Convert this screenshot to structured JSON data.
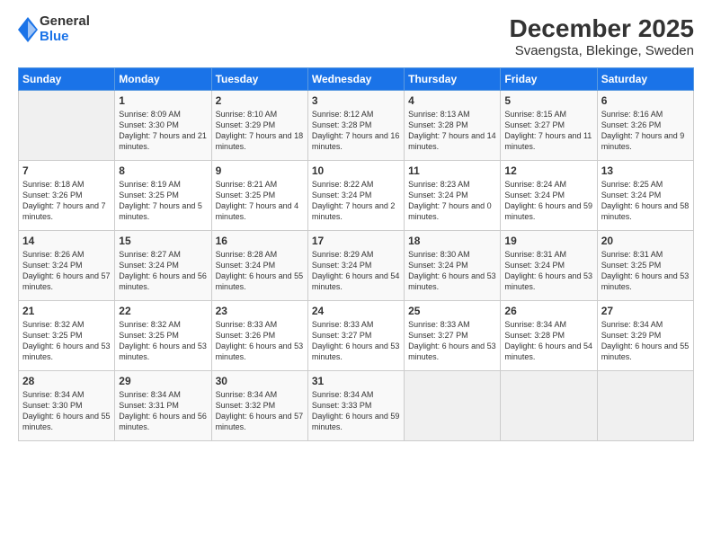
{
  "logo": {
    "general": "General",
    "blue": "Blue"
  },
  "title": "December 2025",
  "subtitle": "Svaengsta, Blekinge, Sweden",
  "header_days": [
    "Sunday",
    "Monday",
    "Tuesday",
    "Wednesday",
    "Thursday",
    "Friday",
    "Saturday"
  ],
  "weeks": [
    [
      {
        "day": "",
        "sunrise": "",
        "sunset": "",
        "daylight": ""
      },
      {
        "day": "1",
        "sunrise": "Sunrise: 8:09 AM",
        "sunset": "Sunset: 3:30 PM",
        "daylight": "Daylight: 7 hours and 21 minutes."
      },
      {
        "day": "2",
        "sunrise": "Sunrise: 8:10 AM",
        "sunset": "Sunset: 3:29 PM",
        "daylight": "Daylight: 7 hours and 18 minutes."
      },
      {
        "day": "3",
        "sunrise": "Sunrise: 8:12 AM",
        "sunset": "Sunset: 3:28 PM",
        "daylight": "Daylight: 7 hours and 16 minutes."
      },
      {
        "day": "4",
        "sunrise": "Sunrise: 8:13 AM",
        "sunset": "Sunset: 3:28 PM",
        "daylight": "Daylight: 7 hours and 14 minutes."
      },
      {
        "day": "5",
        "sunrise": "Sunrise: 8:15 AM",
        "sunset": "Sunset: 3:27 PM",
        "daylight": "Daylight: 7 hours and 11 minutes."
      },
      {
        "day": "6",
        "sunrise": "Sunrise: 8:16 AM",
        "sunset": "Sunset: 3:26 PM",
        "daylight": "Daylight: 7 hours and 9 minutes."
      }
    ],
    [
      {
        "day": "7",
        "sunrise": "Sunrise: 8:18 AM",
        "sunset": "Sunset: 3:26 PM",
        "daylight": "Daylight: 7 hours and 7 minutes."
      },
      {
        "day": "8",
        "sunrise": "Sunrise: 8:19 AM",
        "sunset": "Sunset: 3:25 PM",
        "daylight": "Daylight: 7 hours and 5 minutes."
      },
      {
        "day": "9",
        "sunrise": "Sunrise: 8:21 AM",
        "sunset": "Sunset: 3:25 PM",
        "daylight": "Daylight: 7 hours and 4 minutes."
      },
      {
        "day": "10",
        "sunrise": "Sunrise: 8:22 AM",
        "sunset": "Sunset: 3:24 PM",
        "daylight": "Daylight: 7 hours and 2 minutes."
      },
      {
        "day": "11",
        "sunrise": "Sunrise: 8:23 AM",
        "sunset": "Sunset: 3:24 PM",
        "daylight": "Daylight: 7 hours and 0 minutes."
      },
      {
        "day": "12",
        "sunrise": "Sunrise: 8:24 AM",
        "sunset": "Sunset: 3:24 PM",
        "daylight": "Daylight: 6 hours and 59 minutes."
      },
      {
        "day": "13",
        "sunrise": "Sunrise: 8:25 AM",
        "sunset": "Sunset: 3:24 PM",
        "daylight": "Daylight: 6 hours and 58 minutes."
      }
    ],
    [
      {
        "day": "14",
        "sunrise": "Sunrise: 8:26 AM",
        "sunset": "Sunset: 3:24 PM",
        "daylight": "Daylight: 6 hours and 57 minutes."
      },
      {
        "day": "15",
        "sunrise": "Sunrise: 8:27 AM",
        "sunset": "Sunset: 3:24 PM",
        "daylight": "Daylight: 6 hours and 56 minutes."
      },
      {
        "day": "16",
        "sunrise": "Sunrise: 8:28 AM",
        "sunset": "Sunset: 3:24 PM",
        "daylight": "Daylight: 6 hours and 55 minutes."
      },
      {
        "day": "17",
        "sunrise": "Sunrise: 8:29 AM",
        "sunset": "Sunset: 3:24 PM",
        "daylight": "Daylight: 6 hours and 54 minutes."
      },
      {
        "day": "18",
        "sunrise": "Sunrise: 8:30 AM",
        "sunset": "Sunset: 3:24 PM",
        "daylight": "Daylight: 6 hours and 53 minutes."
      },
      {
        "day": "19",
        "sunrise": "Sunrise: 8:31 AM",
        "sunset": "Sunset: 3:24 PM",
        "daylight": "Daylight: 6 hours and 53 minutes."
      },
      {
        "day": "20",
        "sunrise": "Sunrise: 8:31 AM",
        "sunset": "Sunset: 3:25 PM",
        "daylight": "Daylight: 6 hours and 53 minutes."
      }
    ],
    [
      {
        "day": "21",
        "sunrise": "Sunrise: 8:32 AM",
        "sunset": "Sunset: 3:25 PM",
        "daylight": "Daylight: 6 hours and 53 minutes."
      },
      {
        "day": "22",
        "sunrise": "Sunrise: 8:32 AM",
        "sunset": "Sunset: 3:25 PM",
        "daylight": "Daylight: 6 hours and 53 minutes."
      },
      {
        "day": "23",
        "sunrise": "Sunrise: 8:33 AM",
        "sunset": "Sunset: 3:26 PM",
        "daylight": "Daylight: 6 hours and 53 minutes."
      },
      {
        "day": "24",
        "sunrise": "Sunrise: 8:33 AM",
        "sunset": "Sunset: 3:27 PM",
        "daylight": "Daylight: 6 hours and 53 minutes."
      },
      {
        "day": "25",
        "sunrise": "Sunrise: 8:33 AM",
        "sunset": "Sunset: 3:27 PM",
        "daylight": "Daylight: 6 hours and 53 minutes."
      },
      {
        "day": "26",
        "sunrise": "Sunrise: 8:34 AM",
        "sunset": "Sunset: 3:28 PM",
        "daylight": "Daylight: 6 hours and 54 minutes."
      },
      {
        "day": "27",
        "sunrise": "Sunrise: 8:34 AM",
        "sunset": "Sunset: 3:29 PM",
        "daylight": "Daylight: 6 hours and 55 minutes."
      }
    ],
    [
      {
        "day": "28",
        "sunrise": "Sunrise: 8:34 AM",
        "sunset": "Sunset: 3:30 PM",
        "daylight": "Daylight: 6 hours and 55 minutes."
      },
      {
        "day": "29",
        "sunrise": "Sunrise: 8:34 AM",
        "sunset": "Sunset: 3:31 PM",
        "daylight": "Daylight: 6 hours and 56 minutes."
      },
      {
        "day": "30",
        "sunrise": "Sunrise: 8:34 AM",
        "sunset": "Sunset: 3:32 PM",
        "daylight": "Daylight: 6 hours and 57 minutes."
      },
      {
        "day": "31",
        "sunrise": "Sunrise: 8:34 AM",
        "sunset": "Sunset: 3:33 PM",
        "daylight": "Daylight: 6 hours and 59 minutes."
      },
      {
        "day": "",
        "sunrise": "",
        "sunset": "",
        "daylight": ""
      },
      {
        "day": "",
        "sunrise": "",
        "sunset": "",
        "daylight": ""
      },
      {
        "day": "",
        "sunrise": "",
        "sunset": "",
        "daylight": ""
      }
    ]
  ]
}
